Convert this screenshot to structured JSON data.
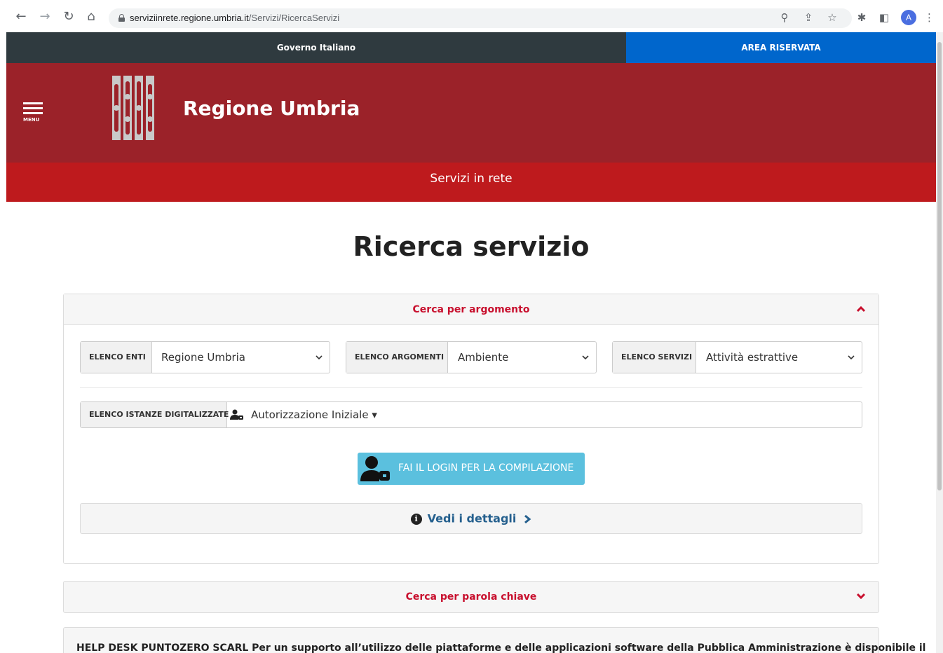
{
  "browser": {
    "url_host": "serviziinrete.regione.umbria.it",
    "url_path": "/Servizi/RicercaServizi",
    "profile_initial": "A"
  },
  "topbar": {
    "gov_label": "Governo Italiano",
    "area_label": "AREA RISERVATA"
  },
  "header": {
    "menu_label": "MENU",
    "brand": "Regione Umbria",
    "subtitle": "Servizi in rete"
  },
  "main": {
    "title": "Ricerca servizio",
    "panel_argomento": {
      "title": "Cerca per argomento",
      "enti": {
        "label": "ELENCO ENTI",
        "value": "Regione Umbria"
      },
      "argomenti": {
        "label": "ELENCO ARGOMENTI",
        "value": "Ambiente"
      },
      "servizi": {
        "label": "ELENCO SERVIZI",
        "value": "Attività estrattive"
      },
      "istanze": {
        "label": "ELENCO ISTANZE DIGITALIZZATE",
        "value": "Autorizzazione Iniziale"
      },
      "login_label": "FAI IL LOGIN PER LA COMPILAZIONE",
      "details_label": "Vedi i dettagli"
    },
    "panel_parola": {
      "title": "Cerca per parola chiave"
    },
    "helpdesk_text": "HELP DESK PUNTOZERO SCARL Per un supporto all’utilizzo delle piattaforme e delle applicazioni software della Pubblica Amministrazione è disponibile il"
  },
  "colors": {
    "header_red": "#9b2229",
    "subbar_red": "#be1a1d",
    "top_dark": "#2f3a3f",
    "area_blue": "#0066cc",
    "accent_red": "#c8102e",
    "login_blue": "#5bc0de",
    "link_blue": "#25608e"
  },
  "icons": [
    "back-arrow-icon",
    "forward-arrow-icon",
    "reload-icon",
    "home-icon",
    "lock-icon",
    "zoom-icon",
    "share-icon",
    "star-icon",
    "extensions-icon",
    "sidepanel-icon",
    "kebab-menu-icon",
    "hamburger-icon",
    "region-logo",
    "chevron-up-icon",
    "chevron-down-icon",
    "user-shield-icon",
    "info-icon",
    "chevron-right-icon"
  ]
}
